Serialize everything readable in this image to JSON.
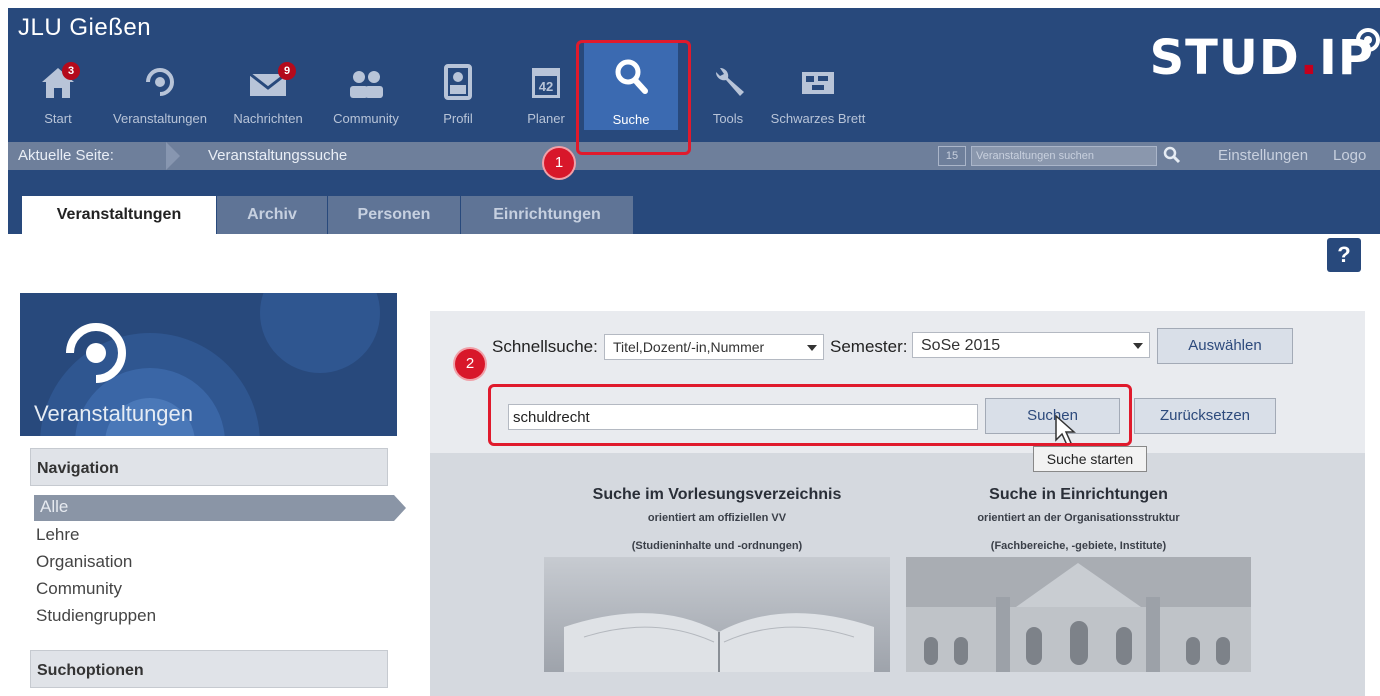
{
  "app": {
    "title": "JLU Gießen",
    "logo": {
      "text": "STUD",
      "dot": ".",
      "suffix": "IP"
    }
  },
  "nav": {
    "items": [
      {
        "label": "Start",
        "icon": "home-icon",
        "badge": "3"
      },
      {
        "label": "Veranstaltungen",
        "icon": "courses-icon"
      },
      {
        "label": "Nachrichten",
        "icon": "mail-icon",
        "badge": "9"
      },
      {
        "label": "Community",
        "icon": "community-icon"
      },
      {
        "label": "Profil",
        "icon": "profile-icon"
      },
      {
        "label": "Planer",
        "icon": "calendar-icon",
        "calendar_number": "42"
      },
      {
        "label": "Suche",
        "icon": "search-icon",
        "active": true
      },
      {
        "label": "Tools",
        "icon": "wrench-icon"
      },
      {
        "label": "Schwarzes Brett",
        "icon": "board-icon"
      }
    ]
  },
  "breadcrumb": {
    "label": "Aktuelle Seite:",
    "page": "Veranstaltungssuche"
  },
  "quicksearch": {
    "calendar_day": "15",
    "placeholder": "Veranstaltungen suchen",
    "settings": "Einstellungen",
    "logout": "Logo"
  },
  "tabs": [
    {
      "label": "Veranstaltungen",
      "active": true
    },
    {
      "label": "Archiv"
    },
    {
      "label": "Personen"
    },
    {
      "label": "Einrichtungen"
    }
  ],
  "help": {
    "symbol": "?"
  },
  "sidebar": {
    "title": "Veranstaltungen",
    "navigation_header": "Navigation",
    "items": [
      {
        "label": "Alle",
        "selected": true
      },
      {
        "label": "Lehre"
      },
      {
        "label": "Organisation"
      },
      {
        "label": "Community"
      },
      {
        "label": "Studiengruppen"
      }
    ],
    "options_header": "Suchoptionen"
  },
  "search": {
    "quick_label": "Schnellsuche:",
    "quick_value": "Titel,Dozent/-in,Nummer",
    "semester_label": "Semester:",
    "semester_value": "SoSe 2015",
    "select_button": "Auswählen",
    "query": "schuldrecht",
    "search_button": "Suchen",
    "reset_button": "Zurücksetzen",
    "tooltip": "Suche starten"
  },
  "boxes": {
    "vv": {
      "title": "Suche im Vorlesungsverzeichnis",
      "line1": "orientiert am offiziellen VV",
      "line2": "(Studieninhalte und -ordnungen)"
    },
    "inst": {
      "title": "Suche in Einrichtungen",
      "line1": "orientiert an der Organisationsstruktur",
      "line2": "(Fachbereiche, -gebiete, Institute)"
    }
  },
  "annotations": {
    "one": "1",
    "two": "2"
  },
  "colors": {
    "header": "#28497c",
    "active_tab": "#3b6ab1",
    "highlight": "#e01a2c",
    "badge": "#b40a1c"
  }
}
